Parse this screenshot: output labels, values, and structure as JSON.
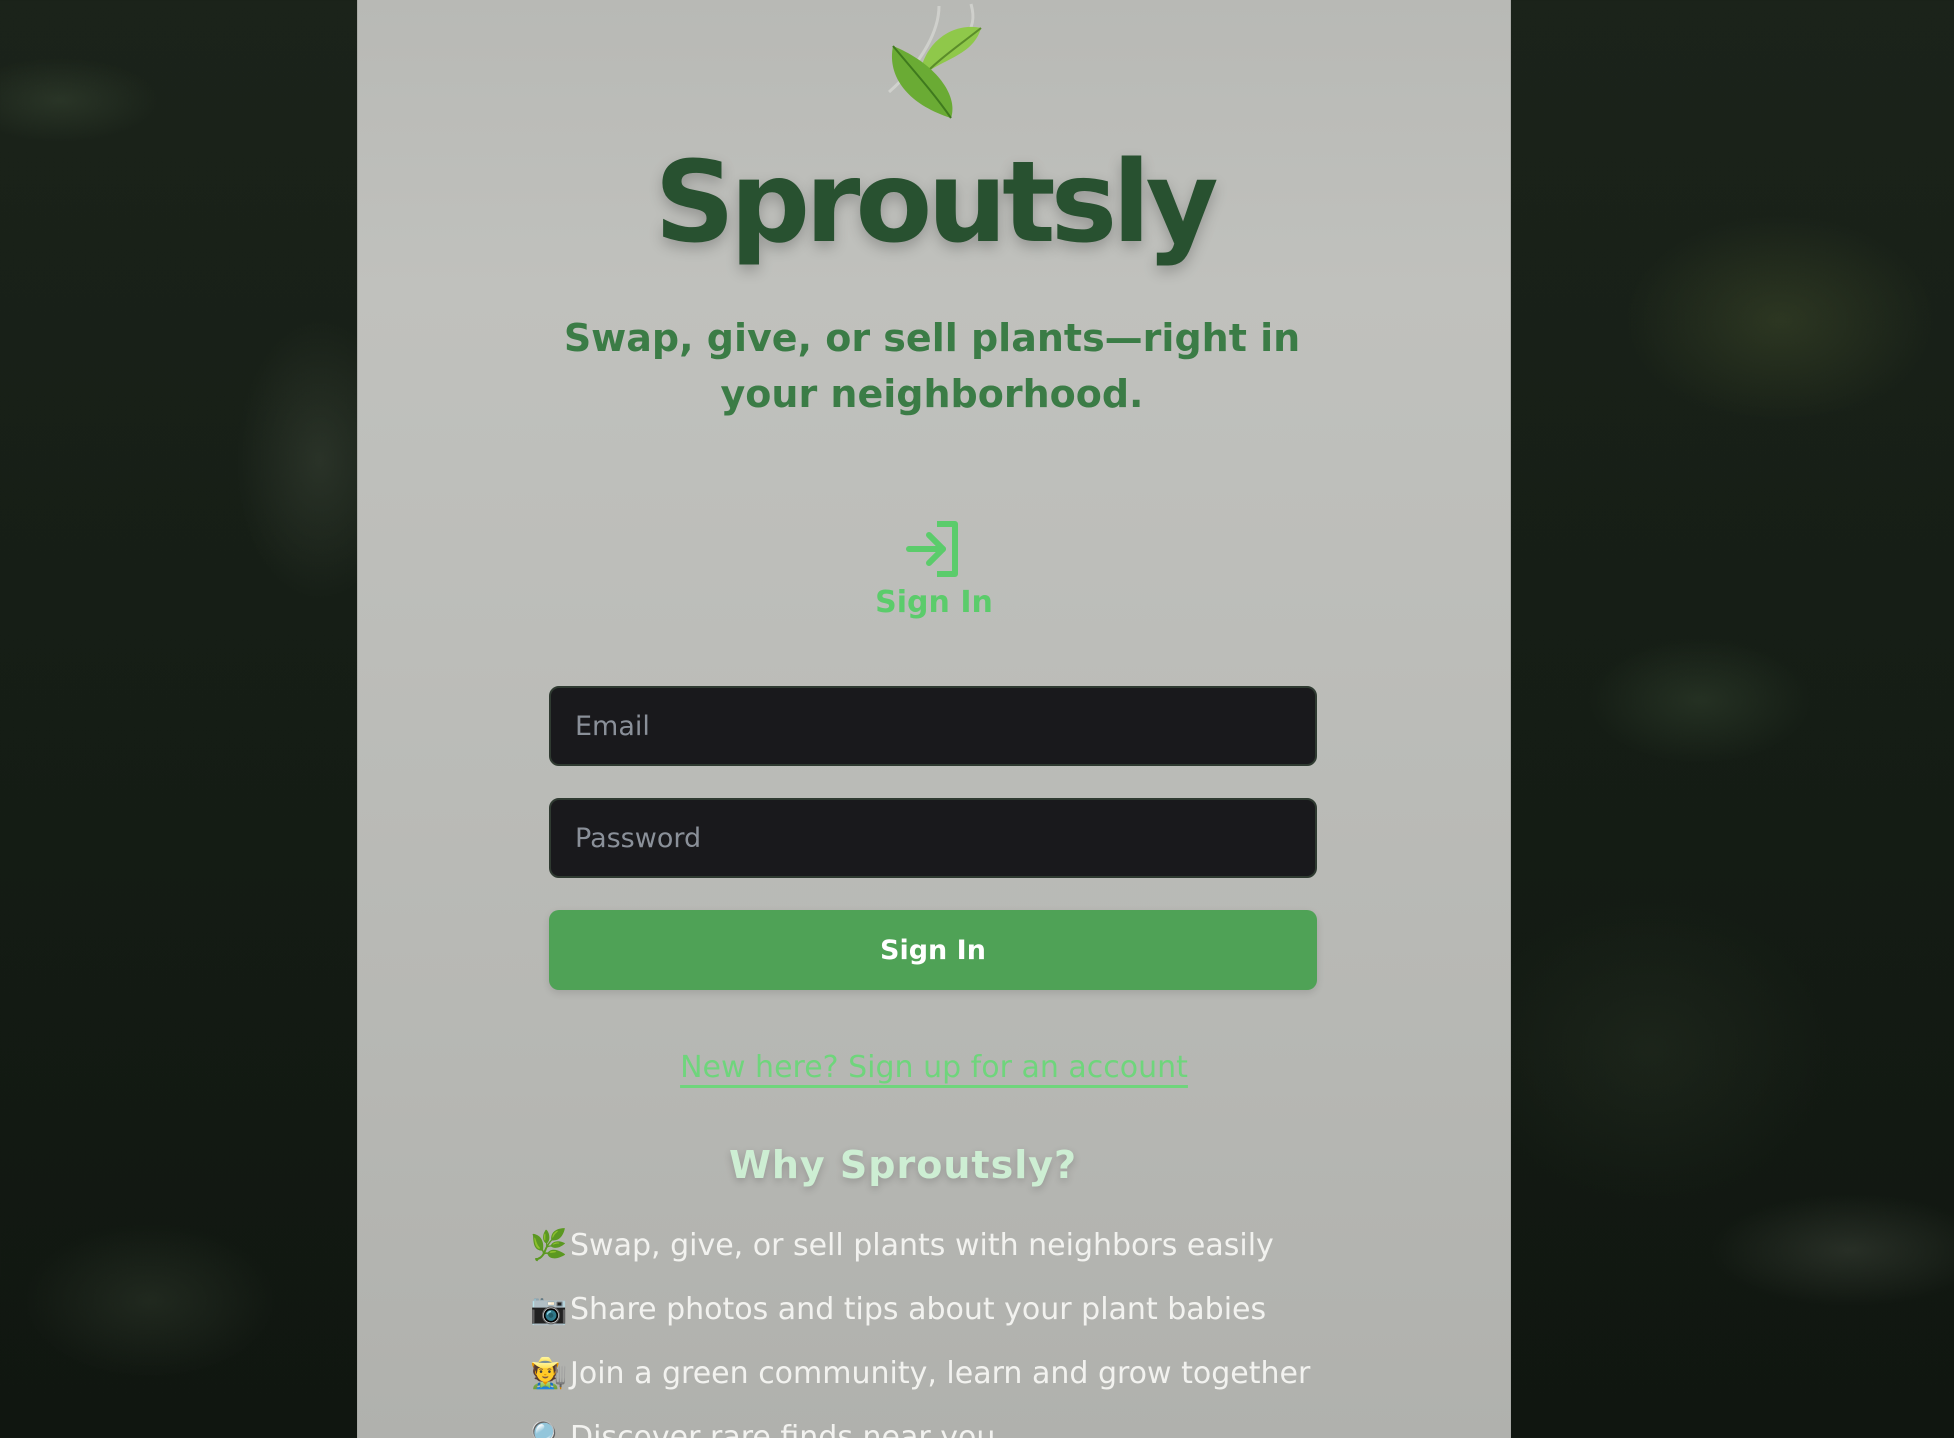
{
  "app": {
    "name": "Sproutsly",
    "tagline": "Swap, give, or sell plants—right in your neighborhood.",
    "logo_icon": "leaves-icon"
  },
  "signin": {
    "heading": "Sign In",
    "icon": "sign-in-icon",
    "email_placeholder": "Email",
    "email_value": "",
    "password_placeholder": "Password",
    "password_value": "",
    "submit_label": "Sign In",
    "signup_link": "New here? Sign up for an account"
  },
  "why": {
    "heading": "Why Sproutsly?",
    "items": [
      {
        "icon": "herb-icon",
        "glyph": "🌿",
        "text": "Swap, give, or sell plants with neighbors easily"
      },
      {
        "icon": "camera-icon",
        "glyph": "📷",
        "text": "Share photos and tips about your plant babies"
      },
      {
        "icon": "farmer-icon",
        "glyph": "🧑‍🌾",
        "text": "Join a green community, learn and grow together"
      },
      {
        "icon": "magnifier-icon",
        "glyph": "🔍",
        "text": "Discover rare finds near you"
      }
    ]
  },
  "colors": {
    "brand_dark": "#285130",
    "brand_green": "#3b7c46",
    "accent": "#4fa256",
    "link": "#6fd57c"
  }
}
